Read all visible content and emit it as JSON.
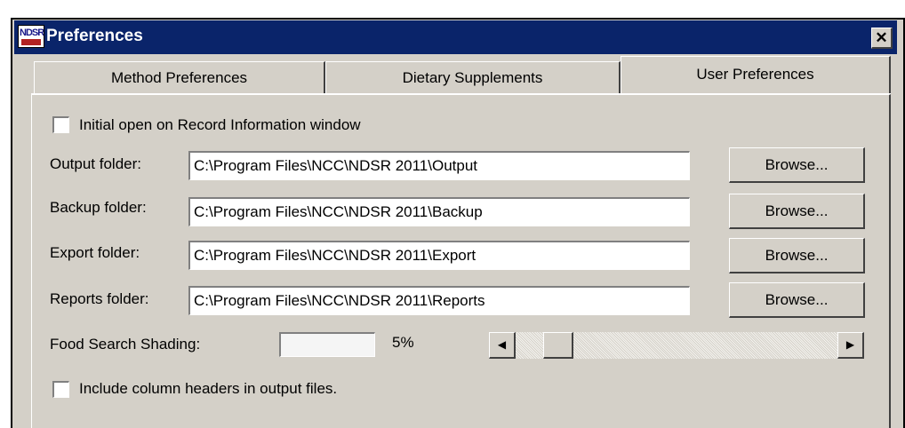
{
  "window": {
    "title": "Preferences",
    "close_glyph": "✕"
  },
  "app_icon": {
    "text": "NDSR"
  },
  "tabs": [
    {
      "label": "Method Preferences",
      "active": false
    },
    {
      "label": "Dietary Supplements",
      "active": false
    },
    {
      "label": "User Preferences",
      "active": true
    }
  ],
  "initial_open": {
    "label": "Initial open on Record Information window",
    "checked": false
  },
  "folders": [
    {
      "label": "Output folder:",
      "value": "C:\\Program Files\\NCC\\NDSR 2011\\Output",
      "button": "Browse..."
    },
    {
      "label": "Backup folder:",
      "value": "C:\\Program Files\\NCC\\NDSR 2011\\Backup",
      "button": "Browse..."
    },
    {
      "label": "Export folder:",
      "value": "C:\\Program Files\\NCC\\NDSR 2011\\Export",
      "button": "Browse..."
    },
    {
      "label": "Reports folder:",
      "value": "C:\\Program Files\\NCC\\NDSR 2011\\Reports",
      "button": "Browse..."
    }
  ],
  "shading": {
    "label": "Food Search Shading:",
    "value_text": "5%",
    "left_arrow": "◀",
    "right_arrow": "▶"
  },
  "include_headers": {
    "label": "Include column headers in output files.",
    "checked": false
  },
  "colors": {
    "titlebar": "#0a246a",
    "face": "#d4d0c8"
  }
}
